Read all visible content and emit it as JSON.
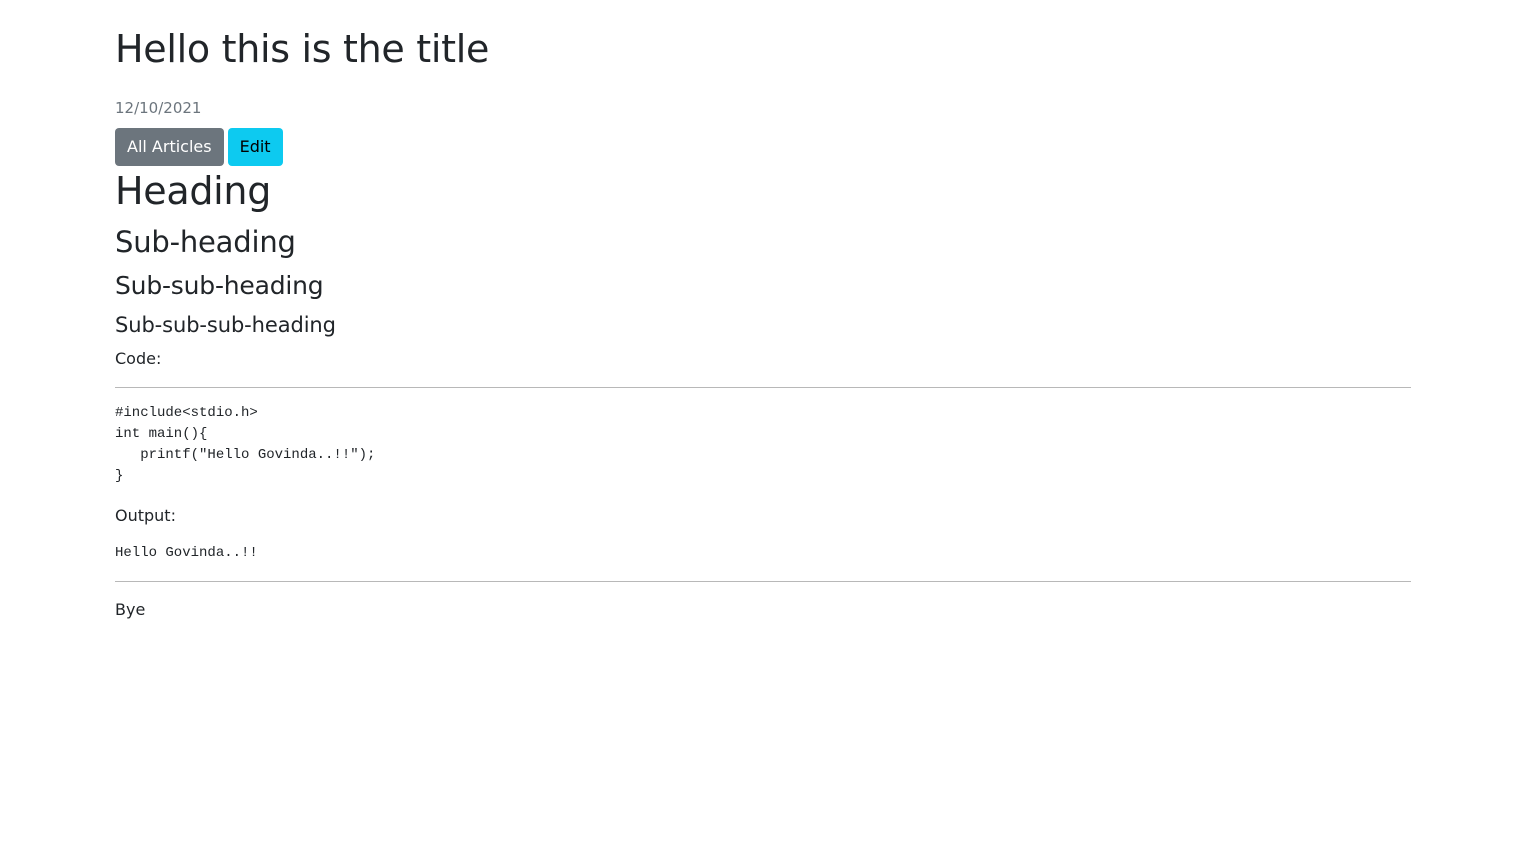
{
  "article": {
    "title": "Hello this is the title",
    "date": "12/10/2021"
  },
  "actions": {
    "all_articles_label": "All Articles",
    "edit_label": "Edit",
    "colors": {
      "secondary": "#6c757d",
      "info": "#0dcaf0"
    }
  },
  "content": {
    "heading": "Heading",
    "sub_heading": "Sub-heading",
    "sub_sub_heading": "Sub-sub-heading",
    "sub_sub_sub_heading": "Sub-sub-sub-heading",
    "code_label": "Code:",
    "code_lines": [
      "#include<stdio.h>",
      "int main(){",
      "   printf(\"Hello Govinda..!!\");",
      "}"
    ],
    "output_label": "Output:",
    "output_text": "Hello Govinda..!!",
    "closing": "Bye"
  }
}
